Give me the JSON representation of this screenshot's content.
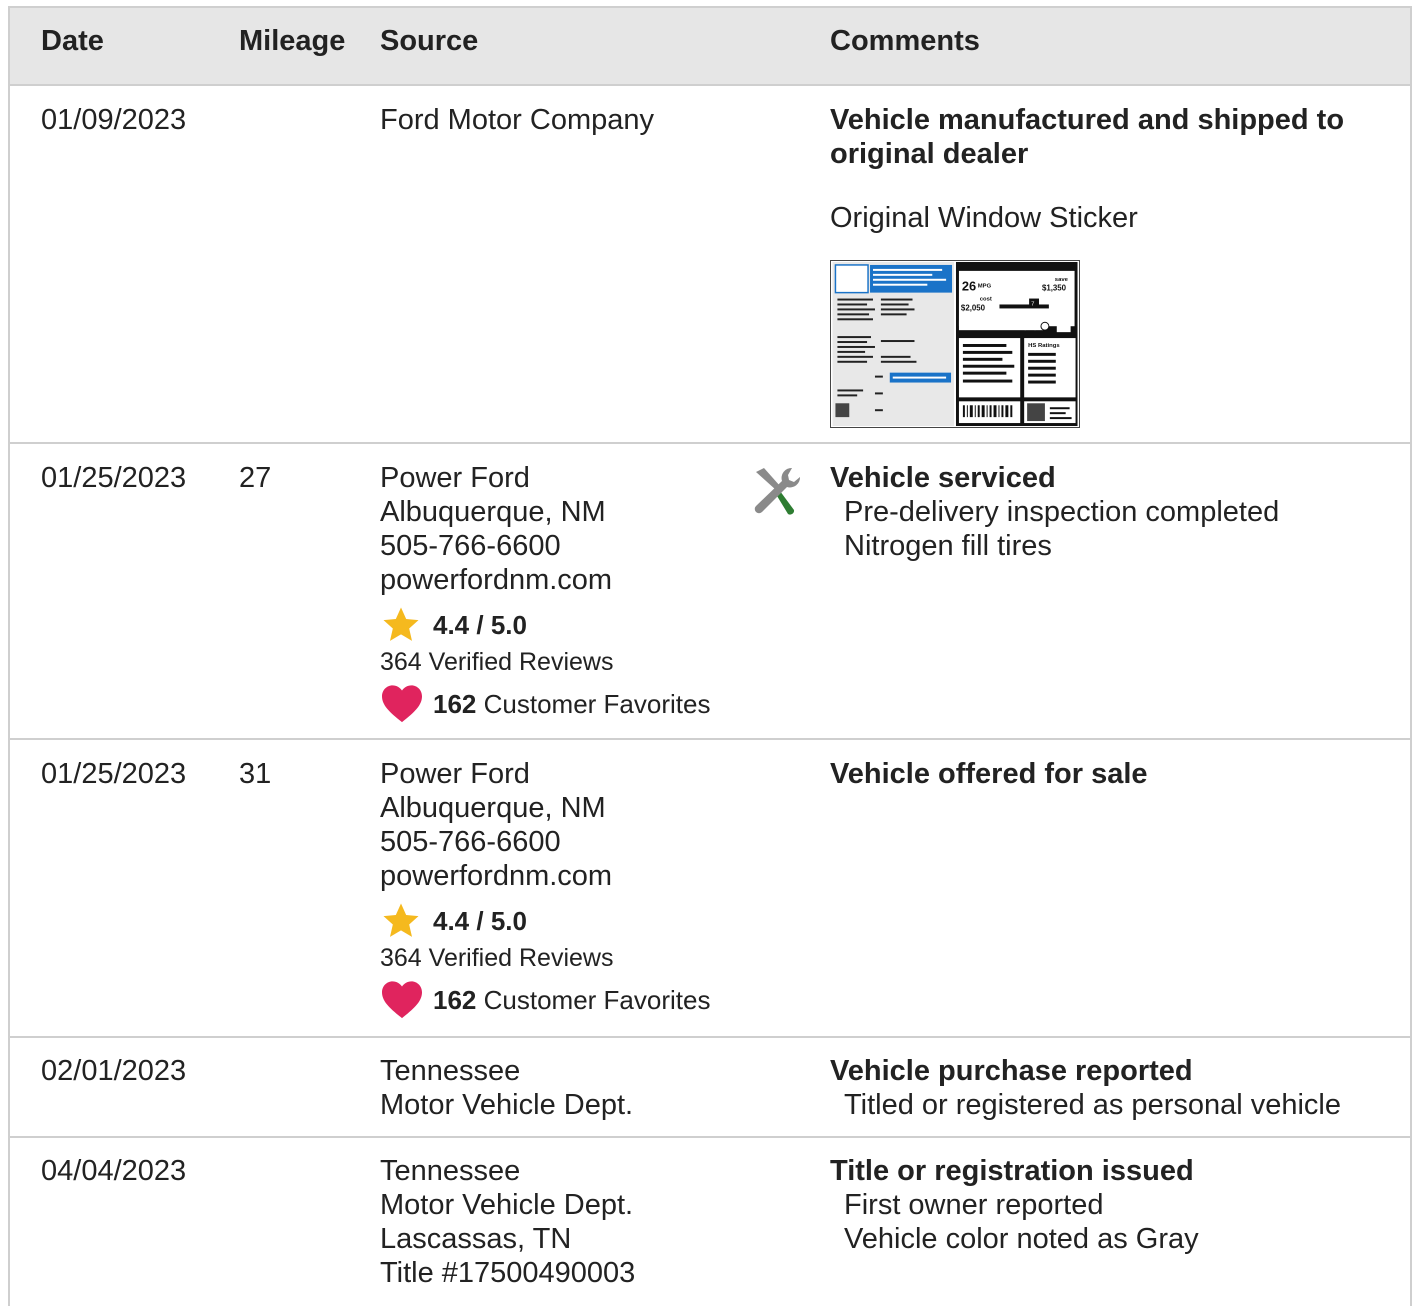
{
  "headers": {
    "date": "Date",
    "mileage": "Mileage",
    "source": "Source",
    "comments": "Comments"
  },
  "rows": [
    {
      "date": "01/09/2023",
      "mileage": "",
      "source": [
        "Ford Motor Company"
      ],
      "comments": {
        "title": [
          "Vehicle manufactured and shipped to",
          "original dealer"
        ],
        "details": []
      },
      "sticker_label": "Original Window Sticker",
      "sticker": {
        "mpg": "26",
        "mpg_unit": "MPG",
        "save_word": "save",
        "save": "$1,350",
        "cost_word": "cost",
        "cost": "$2,050",
        "ratings": "HS Ratings",
        "rating_num": "7"
      }
    },
    {
      "date": "01/25/2023",
      "mileage": "27",
      "source": [
        "Power Ford",
        "Albuquerque, NM",
        "505-766-6600",
        "powerfordnm.com"
      ],
      "rating": "4.4 / 5.0",
      "reviews": "364 Verified Reviews",
      "favorites_count": "162",
      "favorites_label": "Customer Favorites",
      "icon": "service-tools-icon",
      "comments": {
        "title": [
          "Vehicle serviced"
        ],
        "details": [
          "Pre-delivery inspection completed",
          "Nitrogen fill tires"
        ]
      }
    },
    {
      "date": "01/25/2023",
      "mileage": "31",
      "source": [
        "Power Ford",
        "Albuquerque, NM",
        "505-766-6600",
        "powerfordnm.com"
      ],
      "rating": "4.4 / 5.0",
      "reviews": "364 Verified Reviews",
      "favorites_count": "162",
      "favorites_label": "Customer Favorites",
      "comments": {
        "title": [
          "Vehicle offered for sale"
        ],
        "details": []
      }
    },
    {
      "date": "02/01/2023",
      "mileage": "",
      "source": [
        "Tennessee",
        "Motor Vehicle Dept."
      ],
      "comments": {
        "title": [
          "Vehicle purchase reported"
        ],
        "details": [
          "Titled or registered as personal vehicle"
        ]
      }
    },
    {
      "date": "04/04/2023",
      "mileage": "",
      "source": [
        "Tennessee",
        "Motor Vehicle Dept.",
        "Lascassas, TN",
        "Title #17500490003"
      ],
      "comments": {
        "title": [
          "Title or registration issued"
        ],
        "details": [
          "First owner reported",
          "Vehicle color noted as Gray"
        ]
      }
    }
  ],
  "colors": {
    "header_bg": "#e6e6e6",
    "border": "#cfcfcf",
    "star": "#f5b91e",
    "heart": "#e0245e",
    "sticker_blue": "#1a73c8",
    "tool_green": "#2e7d32",
    "tool_gray": "#8a8a8a"
  }
}
